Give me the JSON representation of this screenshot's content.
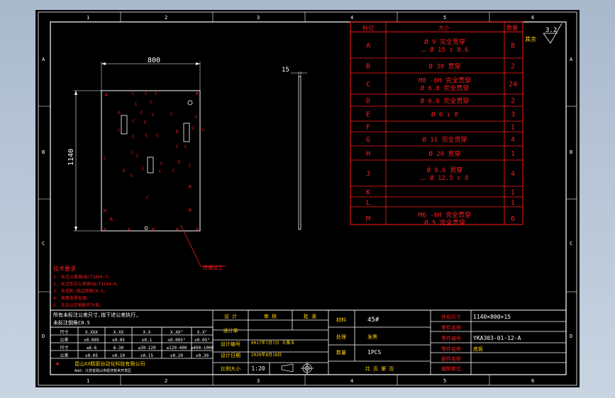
{
  "zone_numbers": {
    "top": [
      "1",
      "2",
      "3",
      "4",
      "5",
      "6"
    ],
    "bottom": [
      "1",
      "2",
      "3",
      "4",
      "5",
      "6"
    ],
    "left": [
      "A",
      "B",
      "C",
      "D"
    ],
    "right": [
      "A",
      "B",
      "C",
      "D"
    ]
  },
  "roughness": {
    "value": "3.2",
    "label": "其余"
  },
  "hole_table": {
    "headers": [
      "标记",
      "大小",
      "数量"
    ],
    "rows": [
      {
        "mark": "A",
        "size": [
          "Ø 9 完全贯穿",
          "⌴ Ø 15 ↧ 8.6"
        ],
        "qty": "8"
      },
      {
        "mark": "B",
        "size": [
          "Ø 30 贯穿"
        ],
        "qty": "2"
      },
      {
        "mark": "C",
        "size": [
          "M8 -6H 完全贯穿",
          "Ø 6.8 完全贯穿"
        ],
        "qty": "24"
      },
      {
        "mark": "D",
        "size": [
          "Ø 6.6 完全贯穿"
        ],
        "qty": "2"
      },
      {
        "mark": "E",
        "size": [
          "Ø 6 ↧ 8"
        ],
        "qty": "3"
      },
      {
        "mark": "F",
        "size": [
          ""
        ],
        "qty": "1"
      },
      {
        "mark": "G",
        "size": [
          "Ø 11 完全贯穿"
        ],
        "qty": "4"
      },
      {
        "mark": "H",
        "size": [
          "Ø 20 贯穿"
        ],
        "qty": "1"
      },
      {
        "mark": "J",
        "size": [
          "Ø 6.6 贯穿",
          "⌴ Ø 12.5 ↧ 8"
        ],
        "qty": "4"
      },
      {
        "mark": "K",
        "size": [
          ""
        ],
        "qty": "1"
      },
      {
        "mark": "L",
        "size": [
          ""
        ],
        "qty": "1"
      },
      {
        "mark": "M",
        "size": [
          "M6 -6H 完全贯穿",
          "Ø 5 完全贯穿"
        ],
        "qty": "6"
      }
    ]
  },
  "front_view": {
    "width_dim": "800",
    "height_dim": "1140",
    "leader_label": "挖槽加工"
  },
  "side_view": {
    "thickness_dim": "15"
  },
  "tech_notes": {
    "title": "技术要求",
    "lines": [
      "1. 未注公差按GB/T1804-f。",
      "2. 未注形位公差按GB/T1184-K。",
      "3. 去毛刺,锐边倒角C0.5。",
      "4. 表面发黑处理。",
      "5. 孔位以实物配作为准。"
    ]
  },
  "tolerance_block": {
    "heading": [
      "所有未标注公差尺寸,按下述公差执行,",
      "未标注倒角C0.5"
    ],
    "cols": [
      "尺寸",
      "X.XXX",
      "X.XX",
      "X.X",
      "X.XX°",
      "X.X°"
    ],
    "rows": [
      [
        "公差",
        "±0.005",
        "±0.05",
        "±0.1",
        "±0.005°",
        "±0.05°"
      ],
      [
        "尺寸",
        "≤6-6",
        "6-30",
        "≤30-120",
        "≤120-400",
        "≤400-1000"
      ],
      [
        "公差",
        "±0.05",
        "±0.10",
        "±0.15",
        "±0.20",
        "±0.30"
      ]
    ]
  },
  "title_block": {
    "design_header": [
      "设 计",
      "审 核",
      "批 准"
    ],
    "designer_label": "设计单",
    "design_no_label": "设计编号",
    "design_no": "0017年7月7日 王雅玉",
    "design_date_label": "设计日期",
    "design_date": "2020年8月18日",
    "scale_label": "比例大小",
    "scale": "1:20",
    "material_label": "材料",
    "material": "45#",
    "finish_label": "处理",
    "finish": "发黑",
    "qty_label": "数量",
    "qty": "1PCS",
    "sheet_label": "共 页 第 页",
    "part_size_label": "外形尺寸",
    "part_size": "1140×800×15",
    "part_name_label": "零件名称",
    "drawing_no_label": "零件编号",
    "drawing_no": "YKA303-01-12-A",
    "assembly_label": "零件名称",
    "assembly": "底板",
    "dept_label": "部件名称",
    "company_label": "编制单位",
    "company": "昆山XX精密自动化科技有限公司",
    "company_sub": "Add: 江苏省昆山市经济技术开发区"
  },
  "colors": {
    "background": "#000000",
    "frame": "#ffffff",
    "red": "#ff1a1a",
    "yellow": "#ffd400",
    "green": "#00e600",
    "cyan": "#00e5e5"
  }
}
